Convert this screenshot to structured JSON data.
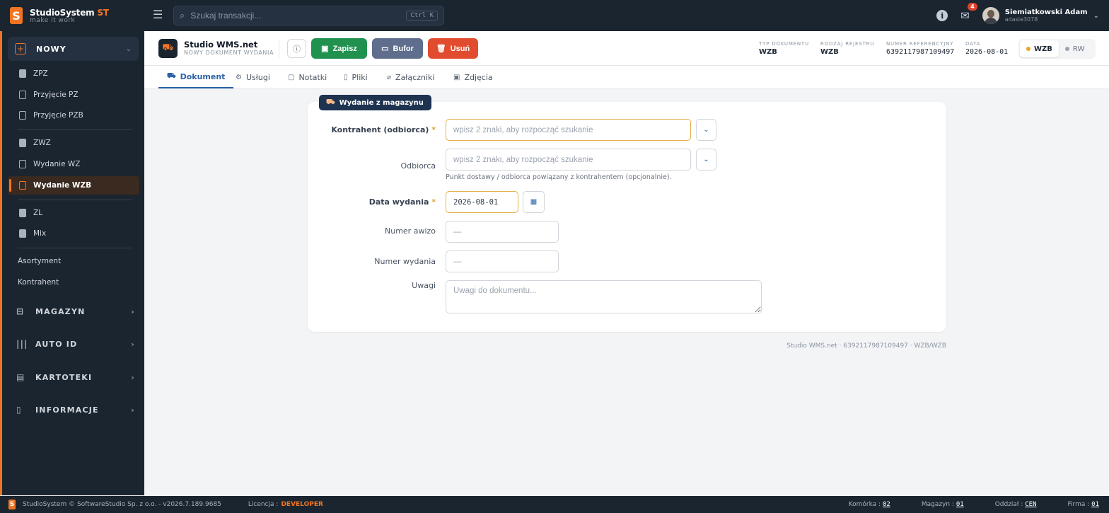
{
  "app": {
    "logo_letter": "S",
    "name_main": "StudioSystem",
    "name_accent": "ST",
    "tagline": "make it work",
    "accent_color": "#f07522"
  },
  "topbar": {
    "search_placeholder": "Szukaj transakcji...",
    "search_shortcut": "Ctrl K",
    "notifications_count": "4",
    "user_name": "Siemiatkowski Adam",
    "user_login": "adasie3078"
  },
  "sidebar": {
    "nowy_label": "NOWY",
    "group1": [
      "ZPZ",
      "Przyjęcie PZ",
      "Przyjęcie PZB"
    ],
    "group2": [
      "ZWZ",
      "Wydanie WZ",
      "Wydanie WZB"
    ],
    "group3": [
      "ZL",
      "Mix"
    ],
    "plain": [
      "Asortyment",
      "Kontrahent"
    ],
    "sections": [
      "MAGAZYN",
      "AUTO ID",
      "KARTOTEKI",
      "INFORMACJE"
    ],
    "active_item": "Wydanie WZB"
  },
  "header": {
    "title": "Studio WMS.net",
    "subtitle": "NOWY DOKUMENT WYDANIA",
    "save_label": "Zapisz",
    "buffer_label": "Bufor",
    "delete_label": "Usuń",
    "meta": [
      {
        "key": "TYP DOKUMENTU",
        "value": "WZB"
      },
      {
        "key": "RODZAJ REJESTRU",
        "value": "WZB"
      },
      {
        "key": "NUMER REFERENCYJNY",
        "value": "6392117987109497"
      },
      {
        "key": "DATA",
        "value": "2026-08-01"
      }
    ],
    "switch": [
      {
        "label": "WZB",
        "active": true,
        "color": "#f0a030"
      },
      {
        "label": "RW",
        "active": false,
        "color": "#9ca3af"
      }
    ]
  },
  "tabs": [
    "Dokument",
    "Usługi",
    "Notatki",
    "Pliki",
    "Załączniki",
    "Zdjęcia"
  ],
  "form": {
    "badge": "Wydanie z magazynu",
    "contractor_label": "Kontrahent (odbiorca)",
    "contractor_placeholder": "wpisz 2 znaki, aby rozpocząć szukanie",
    "recipient_label": "Odbiorca",
    "recipient_placeholder": "wpisz 2 znaki, aby rozpocząć szukanie",
    "recipient_hint": "Punkt dostawy / odbiorca powiązany z kontrahentem (opcjonalnie).",
    "date_label": "Data wydania",
    "date_value": "2026-08-01",
    "awizo_label": "Numer awizo",
    "awizo_placeholder": "—",
    "issue_no_label": "Numer wydania",
    "issue_no_placeholder": "—",
    "notes_label": "Uwagi",
    "notes_placeholder": "Uwagi do dokumentu..."
  },
  "footer_note": "Studio WMS.net · 6392117987109497 · WZB/WZB",
  "statusbar": {
    "copyright": "StudioSystem © SoftwareStudio Sp. z o.o. - v2026.7.189.9685",
    "license_label": "Licencja :",
    "license_value": "DEVELOPER",
    "cell_label": "Komórka :",
    "cell_value": "02",
    "warehouse_label": "Magazyn :",
    "warehouse_value": "01",
    "branch_label": "Oddział :",
    "branch_value": "CEN",
    "company_label": "Firma :",
    "company_value": "01"
  }
}
